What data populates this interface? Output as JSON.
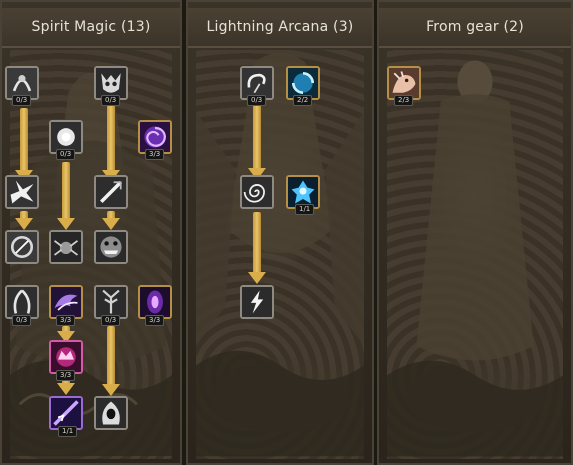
{
  "panels": [
    {
      "title": "Spirit Magic (13)"
    },
    {
      "title": "Lightning Arcana (3)"
    },
    {
      "title": "From gear (2)"
    }
  ],
  "skills": {
    "spirit": {
      "s1": "0/3",
      "s2": "0/3",
      "s3": "0/3",
      "s4": "3/3",
      "s5": "0/3",
      "s6": "3/3",
      "s7": "0/3",
      "s8": "3/3",
      "s9": "3/3",
      "s10": "1/1"
    },
    "lightning": {
      "l1": "0/3",
      "l2": "2/2",
      "l3": "1/1"
    },
    "gear": {
      "g1": "2/3"
    }
  },
  "colors": {
    "link": "#d9ad4a",
    "border_gold": "#b48f45",
    "text": "#e8e2d6"
  }
}
